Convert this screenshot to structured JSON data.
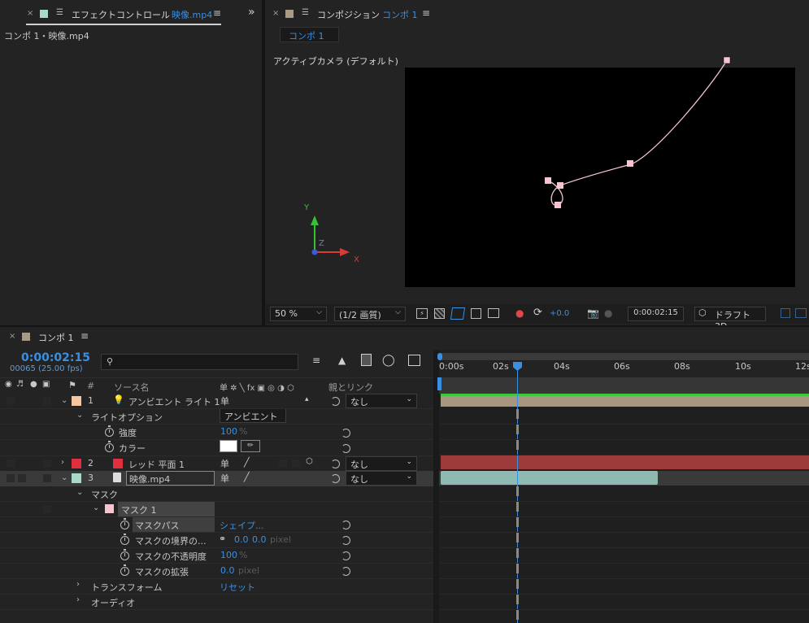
{
  "effects_panel": {
    "close": "×",
    "lock": "🔓",
    "title": "エフェクトコントロール",
    "file": "映像.mp4",
    "menu": "≡",
    "expand": "»",
    "breadcrumb": "コンポ 1・映像.mp4"
  },
  "comp_panel": {
    "close": "×",
    "lock": "🔓",
    "title": "コンポジション",
    "comp_name": "コンポ 1",
    "menu": "≡",
    "tab": "コンポ 1",
    "view_label": "アクティブカメラ (デフォルト)",
    "axis_y": "Y",
    "axis_z": "Z",
    "axis_x": "X"
  },
  "viewer_toolbar": {
    "zoom": "50 %",
    "resolution": "(1/2 画質)",
    "exposure": "+0.0",
    "timecode": "0:00:02:15",
    "renderer": "ドラフト 3D"
  },
  "timeline": {
    "close": "×",
    "title": "コンポ 1",
    "menu": "≡",
    "current_time": "0:00:02:15",
    "frames": "00065 (25.00 fps)",
    "search_placeholder": "",
    "col_num": "#",
    "col_source": "ソース名",
    "col_switches": "单 ✲ ╲ fx ▣ ◎ ◑ ⬡",
    "col_parent": "親とリンク",
    "ruler": [
      "0:00s",
      "02s",
      "04s",
      "06s",
      "08s",
      "10s",
      "12s"
    ],
    "playhead_fraction": 0.21,
    "colors": {
      "layer1": "#f5c6a0",
      "layer2": "#e03040",
      "layer3": "#a8d8cc",
      "mask": "#f7c5d0",
      "accent": "#3b8fe0"
    }
  },
  "layers": {
    "l1": {
      "num": "1",
      "name": "アンビエント ライト 1",
      "parent": "なし"
    },
    "l1_options": "ライトオプション",
    "l1_option_value": "アンビエント",
    "l1_intensity_label": "強度",
    "l1_intensity_value": "100",
    "l1_intensity_unit": "%",
    "l1_color_label": "カラー",
    "l2": {
      "num": "2",
      "name": "レッド 平面 1",
      "parent": "なし"
    },
    "l3": {
      "num": "3",
      "name": "映像.mp4",
      "parent": "なし"
    },
    "mask_group": "マスク",
    "mask1": "マスク 1",
    "mask_path_label": "マスクパス",
    "mask_path_value": "シェイプ...",
    "mask_feather_label": "マスクの境界の...",
    "mask_feather_x": "0.0",
    "mask_feather_y": "0.0",
    "mask_feather_unit": "pixel",
    "mask_opacity_label": "マスクの不透明度",
    "mask_opacity_value": "100",
    "mask_opacity_unit": "%",
    "mask_expand_label": "マスクの拡張",
    "mask_expand_value": "0.0",
    "mask_expand_unit": "pixel",
    "transform_label": "トランスフォーム",
    "transform_value": "リセット",
    "audio_label": "オーディオ"
  }
}
